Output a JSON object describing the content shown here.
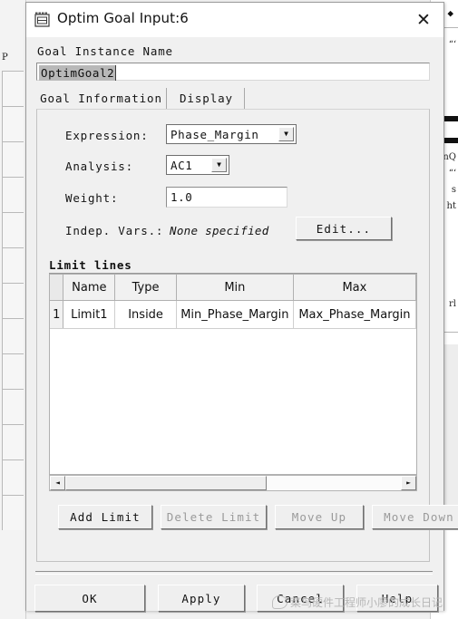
{
  "window": {
    "title": "Optim Goal Input:6",
    "icon": "form-window-icon",
    "close_label": "✕"
  },
  "goal_instance": {
    "label": "Goal Instance Name",
    "value": "OptimGoal2",
    "placeholder": ""
  },
  "tabs": [
    {
      "label": "Goal Information",
      "active": true
    },
    {
      "label": "Display",
      "active": false
    }
  ],
  "form": {
    "expression": {
      "label": "Expression:",
      "value": "Phase_Margin",
      "arrow": "▼"
    },
    "analysis": {
      "label": "Analysis:",
      "value": "AC1",
      "arrow": "▼"
    },
    "weight": {
      "label": "Weight:",
      "value": "1.0"
    },
    "indep_vars": {
      "label": "Indep. Vars.:",
      "value": "None specified"
    },
    "edit_button": "Edit..."
  },
  "limit_lines": {
    "title": "Limit lines",
    "columns": [
      "",
      "Name",
      "Type",
      "Min",
      "Max"
    ],
    "rows": [
      {
        "num": "1",
        "name": "Limit1",
        "type": "Inside",
        "min": "Min_Phase_Margin",
        "max": "Max_Phase_Margin"
      }
    ],
    "scrollbar": {
      "left_arrow": "◄",
      "right_arrow": "►",
      "thumb_percent": 60
    },
    "buttons": [
      {
        "label": "Add Limit",
        "enabled": true
      },
      {
        "label": "Delete Limit",
        "enabled": false
      },
      {
        "label": "Move Up",
        "enabled": false
      },
      {
        "label": "Move Down",
        "enabled": false
      }
    ]
  },
  "footer_buttons": [
    {
      "label": "OK"
    },
    {
      "label": "Apply"
    },
    {
      "label": "Cancel"
    },
    {
      "label": "Help"
    }
  ],
  "watermark": {
    "text": "菜鸟硬件工程师小廖的成长日记"
  },
  "background": {
    "left_label": "P",
    "right_marks": [
      "nQ",
      "“‘",
      "s",
      "ht",
      "rl"
    ]
  }
}
